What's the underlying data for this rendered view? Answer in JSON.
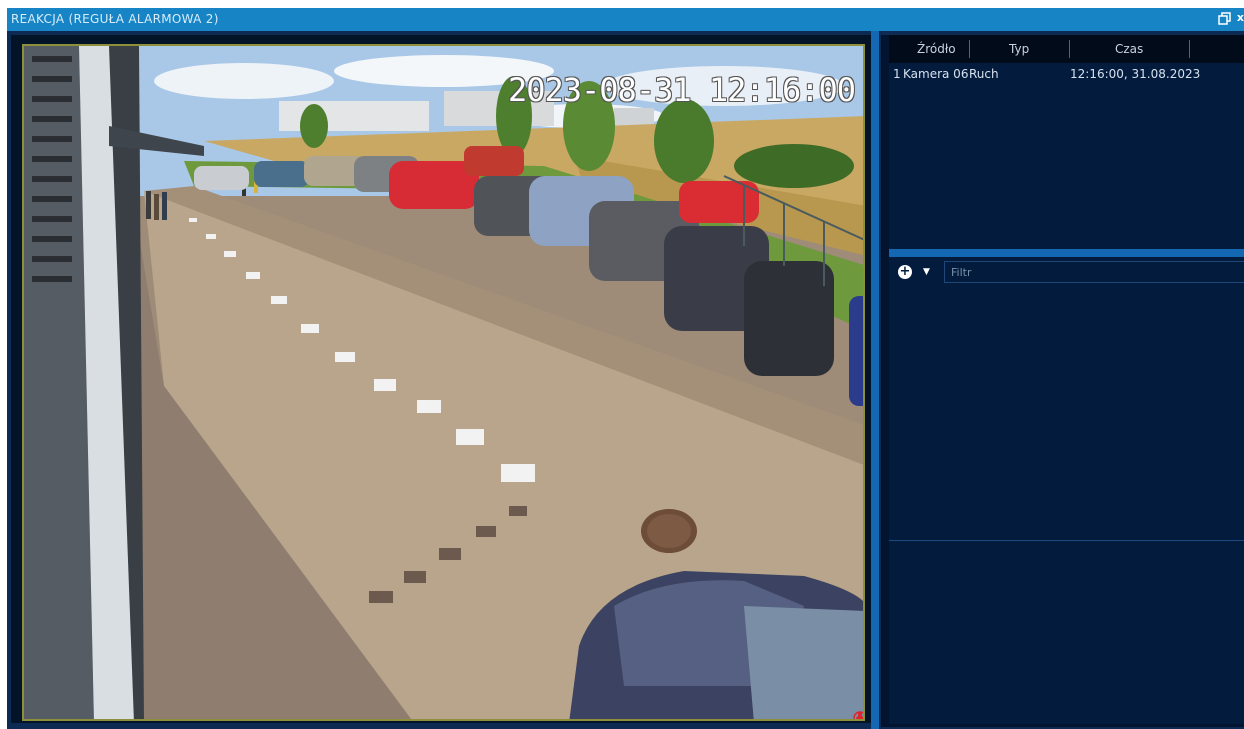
{
  "window": {
    "title": "REAKCJA (REGUŁA  ALARMOWA  2)",
    "close_label": "x"
  },
  "video": {
    "timestamp": "2023-08-31 12:16:00"
  },
  "events": {
    "columns": [
      "Źródło",
      "Typ",
      "Czas"
    ],
    "rows": [
      {
        "index": "1",
        "source": "Kamera 06",
        "type": "Ruch",
        "time": "12:16:00, 31.08.2023"
      }
    ]
  },
  "filter": {
    "placeholder": "Filtr"
  },
  "colors": {
    "titlebar": "#1784c6",
    "panel": "#031c3d",
    "splitter": "#1468b3"
  }
}
